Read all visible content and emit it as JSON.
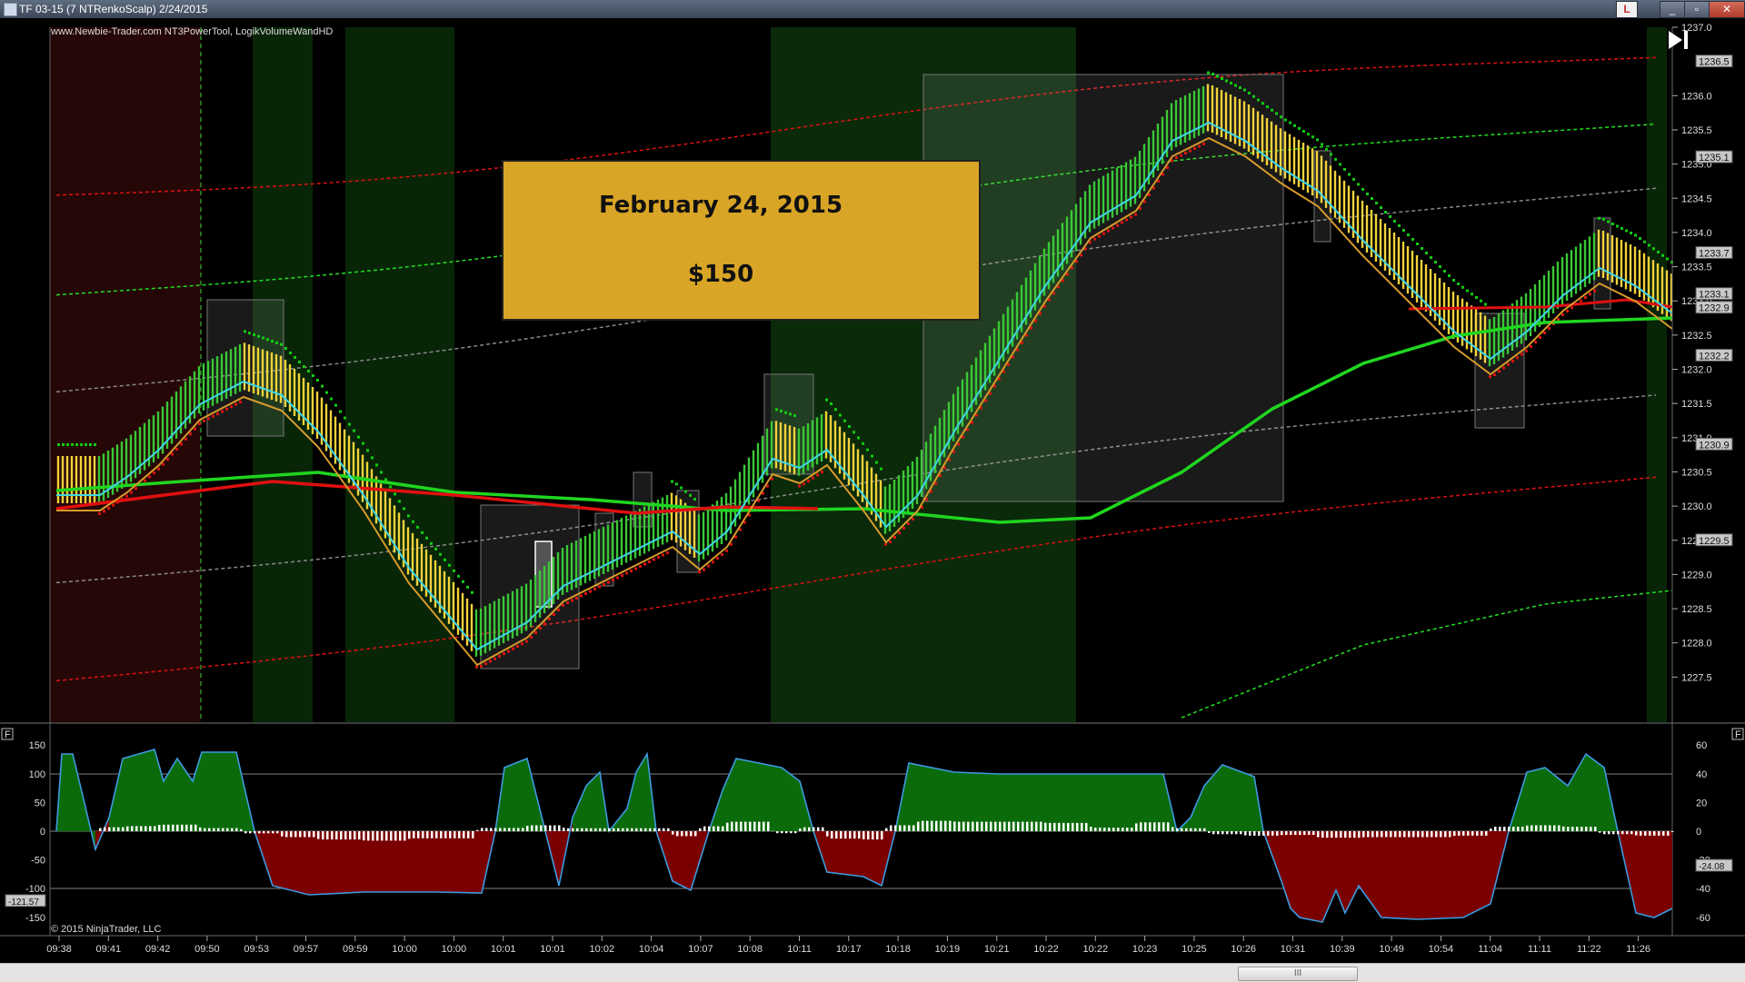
{
  "window": {
    "title": "TF 03-15 (7 NTRenkoScalp)  2/24/2015",
    "link_button": "L",
    "min_icon": "minimize-icon",
    "max_icon": "maximize-icon",
    "close_icon": "close-icon"
  },
  "chart": {
    "indicators_label": "www.Newbie-Trader.com NT3PowerTool, LogikVolumeWandHD",
    "copyright": "© 2015 NinjaTrader, LLC",
    "callout": {
      "date": "February 24, 2015",
      "amount": "$150"
    },
    "price_ticks": [
      "1237.0",
      "1236.0",
      "1235.5",
      "1235.0",
      "1234.5",
      "1234.0",
      "1233.5",
      "1233.0",
      "1232.5",
      "1232.0",
      "1231.5",
      "1231.0",
      "1230.5",
      "1230.0",
      "1229.5",
      "1229.0",
      "1228.5",
      "1228.0",
      "1227.5"
    ],
    "price_ticks_top": "1236.5",
    "price_markers": [
      "1236.5",
      "1235.1",
      "1233.7",
      "1233.1",
      "1232.9",
      "1232.2",
      "1230.9",
      "1229.5"
    ],
    "osc_left_ticks": [
      "150",
      "100",
      "50",
      "0",
      "-50",
      "-100",
      "-150"
    ],
    "osc_right_ticks": [
      "60",
      "40",
      "20",
      "0",
      "-20",
      "-40",
      "-60"
    ],
    "osc_left_marker": "-121.57",
    "osc_right_marker": "-24.08",
    "time_labels": [
      "09:38",
      "09:41",
      "09:42",
      "09:50",
      "09:53",
      "09:57",
      "09:59",
      "10:00",
      "10:00",
      "10:01",
      "10:01",
      "10:02",
      "10:04",
      "10:07",
      "10:08",
      "10:11",
      "10:17",
      "10:18",
      "10:19",
      "10:21",
      "10:22",
      "10:22",
      "10:23",
      "10:25",
      "10:26",
      "10:31",
      "10:39",
      "10:49",
      "10:54",
      "11:04",
      "11:11",
      "11:22",
      "11:26"
    ],
    "panel_button": "F",
    "colors": {
      "up_bar": "#39c935",
      "down_bar": "#f4d23a",
      "accent_gold": "#d9a526",
      "ema_red": "#e01010",
      "ema_green": "#1fd61f",
      "ema_cyan": "#3fd6e6",
      "ema_orange": "#d79b2a"
    }
  },
  "scrollbar": {
    "grip": "III"
  }
}
